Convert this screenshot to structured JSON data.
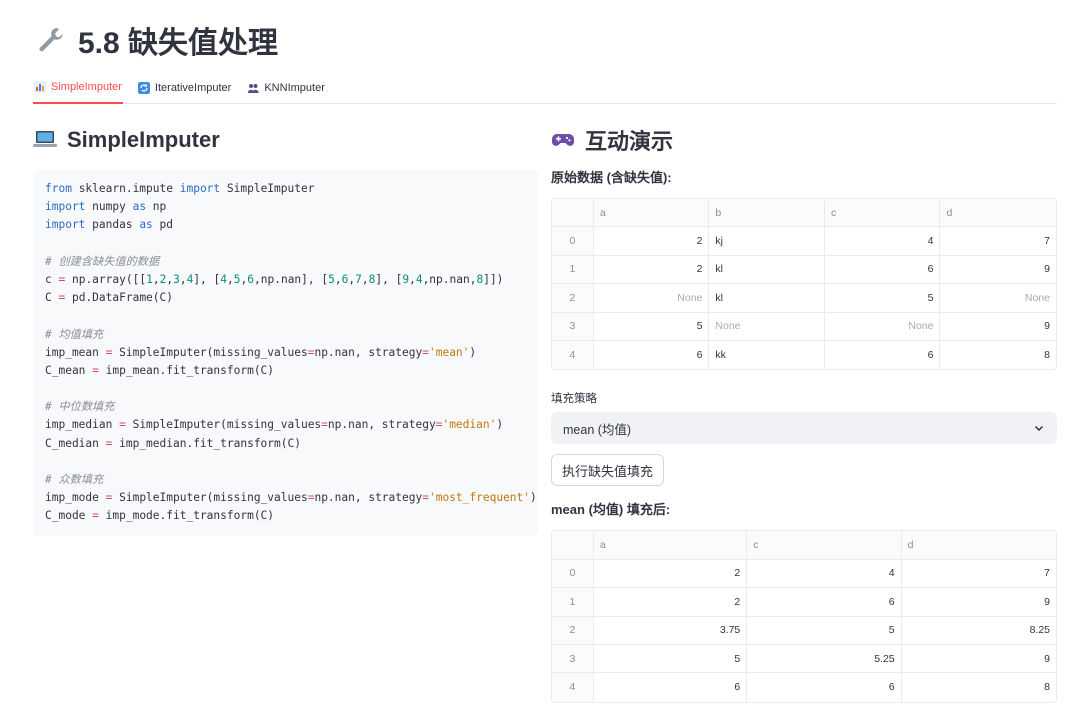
{
  "page": {
    "title": "5.8 缺失值处理"
  },
  "tabs": [
    {
      "label": "SimpleImputer",
      "active": true
    },
    {
      "label": "IterativeImputer",
      "active": false
    },
    {
      "label": "KNNImputer",
      "active": false
    }
  ],
  "left": {
    "heading": "SimpleImputer"
  },
  "right": {
    "heading": "互动演示",
    "original_label": "原始数据 (含缺失值):",
    "original_table": {
      "columns": [
        "a",
        "b",
        "c",
        "d"
      ],
      "rows": [
        {
          "index": "0",
          "cells": [
            "2",
            "kj",
            "4",
            "7"
          ]
        },
        {
          "index": "1",
          "cells": [
            "2",
            "kl",
            "6",
            "9"
          ]
        },
        {
          "index": "2",
          "cells": [
            "None",
            "kl",
            "5",
            "None"
          ]
        },
        {
          "index": "3",
          "cells": [
            "5",
            "None",
            "None",
            "9"
          ]
        },
        {
          "index": "4",
          "cells": [
            "6",
            "kk",
            "6",
            "8"
          ]
        }
      ]
    },
    "strategy_label": "填充策略",
    "strategy_value": "mean (均值)",
    "run_button": "执行缺失值填充",
    "result_label": "mean (均值) 填充后:",
    "result_table": {
      "columns": [
        "a",
        "c",
        "d"
      ],
      "rows": [
        {
          "index": "0",
          "cells": [
            "2",
            "4",
            "7"
          ]
        },
        {
          "index": "1",
          "cells": [
            "2",
            "6",
            "9"
          ]
        },
        {
          "index": "2",
          "cells": [
            "3.75",
            "5",
            "8.25"
          ]
        },
        {
          "index": "3",
          "cells": [
            "5",
            "5.25",
            "9"
          ]
        },
        {
          "index": "4",
          "cells": [
            "6",
            "6",
            "8"
          ]
        }
      ]
    }
  },
  "code": {
    "l1": {
      "a": "from",
      "b": " sklearn.impute ",
      "c": "import",
      "d": " SimpleImputer"
    },
    "l2": {
      "a": "import",
      "b": " numpy ",
      "c": "as",
      "d": " np"
    },
    "l3": {
      "a": "import",
      "b": " pandas ",
      "c": "as",
      "d": " pd"
    },
    "l5": "# 创建含缺失值的数据",
    "l6": {
      "a": "c ",
      "b": "=",
      "c": " np.array([[",
      "d": "1",
      "e": ",",
      "f": "2",
      "g": ",",
      "h": "3",
      "i": ",",
      "j": "4",
      "k": "], [",
      "m": "4",
      "n": ",",
      "o": "5",
      "p": ",",
      "q": "6",
      "r": ",np.nan], [",
      "s": "5",
      "t": ",",
      "u": "6",
      "v": ",",
      "w": "7",
      "x": ",",
      "y": "8",
      "z": "], [",
      "aa": "9",
      "ab": ",",
      "ac": "4",
      "ad": ",np.nan,",
      "ae": "8",
      "af": "]])"
    },
    "l7": {
      "a": "C ",
      "b": "=",
      "c": " pd.DataFrame(C)"
    },
    "l9": "# 均值填充",
    "l10": {
      "a": "imp_mean ",
      "b": "=",
      "c": " SimpleImputer(missing_values",
      "d": "=",
      "e": "np.nan, strategy",
      "f": "=",
      "g": "'mean'",
      "h": ")"
    },
    "l11": {
      "a": "C_mean ",
      "b": "=",
      "c": " imp_mean.fit_transform(C)"
    },
    "l13": "# 中位数填充",
    "l14": {
      "a": "imp_median ",
      "b": "=",
      "c": " SimpleImputer(missing_values",
      "d": "=",
      "e": "np.nan, strategy",
      "f": "=",
      "g": "'median'",
      "h": ")"
    },
    "l15": {
      "a": "C_median ",
      "b": "=",
      "c": " imp_median.fit_transform(C)"
    },
    "l17": "# 众数填充",
    "l18": {
      "a": "imp_mode ",
      "b": "=",
      "c": " SimpleImputer(missing_values",
      "d": "=",
      "e": "np.nan, strategy",
      "f": "=",
      "g": "'most_frequent'",
      "h": ")"
    },
    "l19": {
      "a": "C_mode ",
      "b": "=",
      "c": " imp_mode.fit_transform(C)"
    }
  },
  "colors": {
    "accent": "#ff4b4b",
    "keyword": "#2b6cc4",
    "number": "#0f8a7e",
    "string": "#c3780a",
    "comment": "#8b8e99"
  },
  "icons": {
    "title": "wrench-icon",
    "tab1": "bar-chart-icon",
    "tab2": "refresh-icon",
    "tab3": "users-icon",
    "left": "laptop-icon",
    "right": "gamepad-icon",
    "select": "chevron-down-icon"
  }
}
